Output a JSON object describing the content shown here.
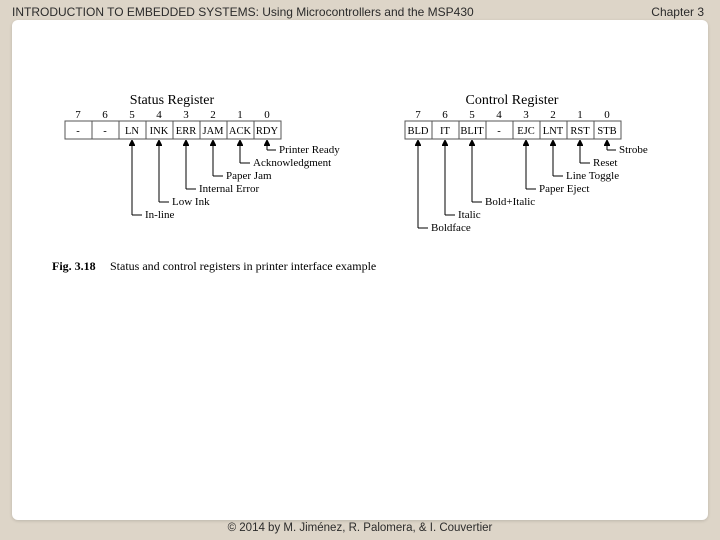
{
  "header": {
    "book_title": "INTRODUCTION TO EMBEDDED SYSTEMS: Using Microcontrollers and the MSP430",
    "chapter": "Chapter 3"
  },
  "footer": "© 2014 by M. Jiménez, R. Palomera, & I. Couvertier",
  "figure": {
    "status": {
      "title": "Status Register",
      "bits": [
        "7",
        "6",
        "5",
        "4",
        "3",
        "2",
        "1",
        "0"
      ],
      "labels": [
        "-",
        "-",
        "LN",
        "INK",
        "ERR",
        "JAM",
        "ACK",
        "RDY"
      ],
      "descs": [
        "Printer Ready",
        "Acknowledgment",
        "Paper Jam",
        "Internal Error",
        "Low Ink",
        "In-line"
      ]
    },
    "control": {
      "title": "Control Register",
      "bits": [
        "7",
        "6",
        "5",
        "4",
        "3",
        "2",
        "1",
        "0"
      ],
      "labels": [
        "BLD",
        "IT",
        "BLIT",
        "-",
        "EJC",
        "LNT",
        "RST",
        "STB"
      ],
      "descs": [
        "Strobe",
        "Reset",
        "Line Toggle",
        "Paper Eject",
        "Bold+Italic",
        "Italic",
        "Boldface"
      ]
    },
    "caption_bold": "Fig. 3.18",
    "caption_rest": "Status and control registers in printer interface example"
  }
}
